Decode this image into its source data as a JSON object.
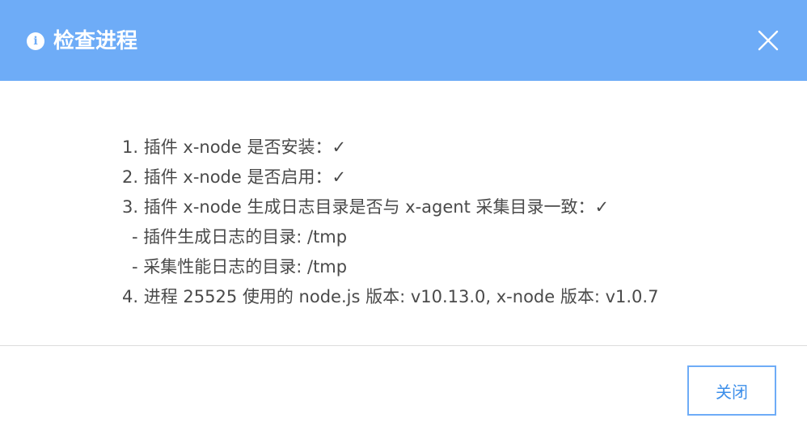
{
  "dialog": {
    "title": "检查进程",
    "info_icon_glyph": "i",
    "close_icon": "close-icon",
    "header_color": "#6eacf7"
  },
  "body": {
    "lines": [
      "1. 插件 x-node 是否安装：✓",
      "2. 插件 x-node 是否启用：✓",
      "3. 插件 x-node 生成日志目录是否与 x-agent 采集目录一致：✓",
      "- 插件生成日志的目录: /tmp",
      "- 采集性能日志的目录: /tmp",
      "4. 进程 25525 使用的 node.js 版本: v10.13.0, x-node 版本: v1.0.7"
    ]
  },
  "footer": {
    "close_label": "关闭"
  }
}
